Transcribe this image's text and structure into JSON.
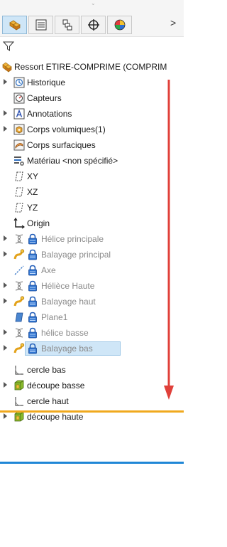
{
  "tabs": [
    {
      "name": "feature-manager",
      "icon": "assembly-icon",
      "active": true
    },
    {
      "name": "property-manager",
      "icon": "property-manager-icon",
      "active": false
    },
    {
      "name": "configuration-manager",
      "icon": "configuration-icon",
      "active": false
    },
    {
      "name": "dimxpert-manager",
      "icon": "crosshair-icon",
      "active": false
    },
    {
      "name": "display-manager",
      "icon": "display-sphere-icon",
      "active": false
    }
  ],
  "more_tabs_label": ">",
  "tree": {
    "root_label": "Ressort ETIRE-COMPRIME  (COMPRIM",
    "items": [
      {
        "label": "Historique"
      },
      {
        "label": "Capteurs"
      },
      {
        "label": "Annotations"
      },
      {
        "label": "Corps volumiques(1)"
      },
      {
        "label": "Corps surfaciques"
      },
      {
        "label": "Matériau <non spécifié>"
      },
      {
        "label": "XY"
      },
      {
        "label": "XZ"
      },
      {
        "label": "YZ"
      },
      {
        "label": "Origin"
      },
      {
        "label": "Hélice principale"
      },
      {
        "label": "Balayage principal"
      },
      {
        "label": "Axe"
      },
      {
        "label": "Hélièce Haute"
      },
      {
        "label": "Balayage haut"
      },
      {
        "label": "Plane1"
      },
      {
        "label": "hélice basse"
      },
      {
        "label": "Balayage bas"
      },
      {
        "label": "cercle bas"
      },
      {
        "label": "découpe basse"
      },
      {
        "label": "cercle haut"
      },
      {
        "label": "découpe haute"
      }
    ]
  },
  "colors": {
    "rollback_bar": "#f0a91e",
    "end_bar": "#1f87d6",
    "annotation_arrow": "#e0403a",
    "selection": "#cfe6f7",
    "suppressed_text": "#8a8a8a"
  }
}
